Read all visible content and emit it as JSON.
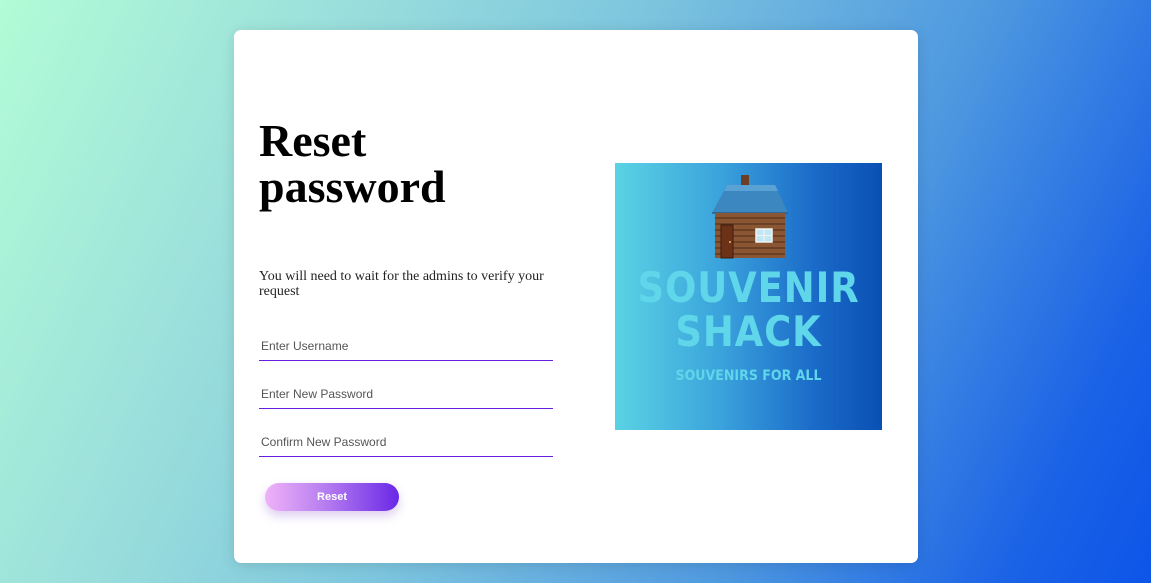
{
  "page": {
    "title": "Reset password",
    "subtitle": "You will need to wait for the admins to verify your request"
  },
  "form": {
    "username_placeholder": "Enter Username",
    "username_value": "",
    "new_password_placeholder": "Enter New Password",
    "new_password_value": "",
    "confirm_password_placeholder": "Confirm New Password",
    "confirm_password_value": "",
    "reset_label": "Reset"
  },
  "logo": {
    "line1": "SOUVENIR",
    "line2": "SHACK",
    "tagline": "SOUVENIRS FOR ALL",
    "icon": "log-cabin-icon"
  },
  "colors": {
    "accent": "#6a1fe0",
    "logo_text": "#5fd6ea"
  }
}
